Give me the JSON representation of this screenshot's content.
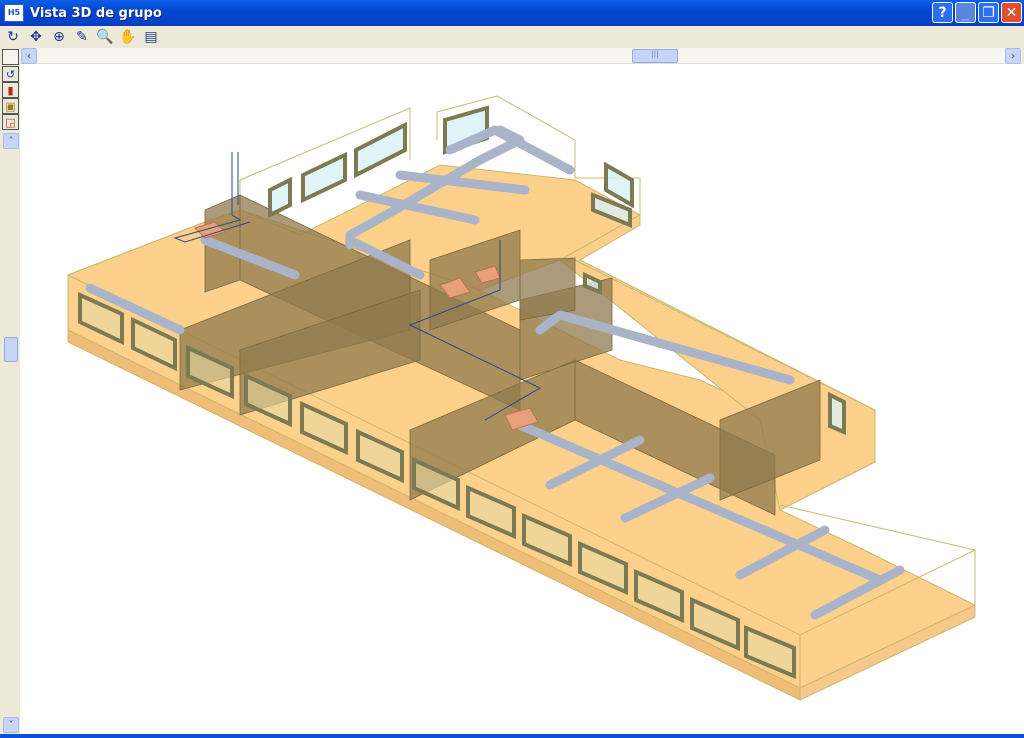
{
  "window": {
    "title": "Vista 3D de grupo",
    "app_icon": "H5"
  },
  "window_buttons": [
    {
      "name": "help",
      "glyph": "?"
    },
    {
      "name": "minimize",
      "glyph": "_"
    },
    {
      "name": "restore",
      "glyph": "❐"
    },
    {
      "name": "close",
      "glyph": "✕"
    }
  ],
  "toolbar": [
    {
      "name": "rotate-view-icon",
      "glyph": "↻"
    },
    {
      "name": "zoom-extents-icon",
      "glyph": "✥"
    },
    {
      "name": "zoom-x2-icon",
      "glyph": "⊕"
    },
    {
      "name": "pencil-icon",
      "glyph": "✎"
    },
    {
      "name": "zoom-window-icon",
      "glyph": "🔍"
    },
    {
      "name": "pan-hand-icon",
      "glyph": "✋"
    },
    {
      "name": "print-preview-icon",
      "glyph": "▤"
    }
  ],
  "left_toolbar": [
    {
      "name": "blank-tool",
      "glyph": ""
    },
    {
      "name": "undo-rotate-icon",
      "glyph": "↺"
    },
    {
      "name": "bars-icon",
      "glyph": "▮"
    },
    {
      "name": "solid-box-icon",
      "glyph": "▣"
    },
    {
      "name": "box-arrow-icon",
      "glyph": "◲"
    }
  ],
  "scroll": {
    "left": "‹",
    "right": "›",
    "up": "˄",
    "down": "˅",
    "thumb": "|||",
    "h_position": 0.62,
    "v_position": 0.42
  },
  "colors": {
    "floor": "#fdd08c",
    "slab_side": "#f5c27a",
    "wall": "#8f7a4e",
    "duct": "#a9b4c8",
    "outline": "#c8b870",
    "window": "#7c7a52"
  }
}
